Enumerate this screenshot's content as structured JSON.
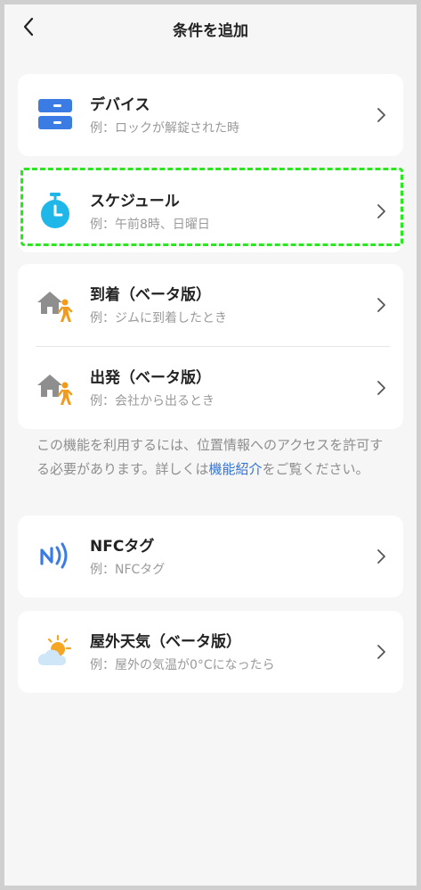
{
  "header": {
    "title": "条件を追加"
  },
  "conditions": {
    "device": {
      "label": "デバイス",
      "example": "例：ロックが解錠された時"
    },
    "schedule": {
      "label": "スケジュール",
      "example": "例：午前8時、日曜日"
    },
    "arrive": {
      "label": "到着（ベータ版）",
      "example": "例：ジムに到着したとき"
    },
    "leave": {
      "label": "出発（ベータ版）",
      "example": "例：会社から出るとき"
    },
    "nfc": {
      "label": "NFCタグ",
      "example": "例：NFCタグ"
    },
    "weather": {
      "label": "屋外天気（ベータ版）",
      "example": "例：屋外の気温が0°Cになったら"
    }
  },
  "note": {
    "before": "この機能を利用するには、位置情報へのアクセスを許可する必要があります。詳しくは",
    "link": "機能紹介",
    "after": "をご覧ください。"
  },
  "colors": {
    "accent_blue": "#3b7ce4",
    "clock_cyan": "#1fb6ea",
    "link_blue": "#2f74d8",
    "highlight_green": "#29e81e"
  }
}
